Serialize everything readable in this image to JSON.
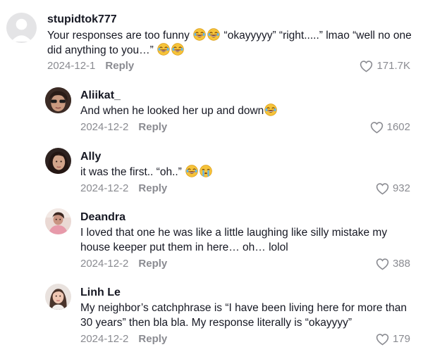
{
  "heart_icon": "heart-outline-icon",
  "colors": {
    "text": "#161823",
    "muted": "#8a8b91"
  },
  "comments": [
    {
      "username": "stupidtok777",
      "text_a": "Your responses are too funny ",
      "text_b": " “okayyyyy” “right.....” lmao “well no one did anything to you…” ",
      "date": "2024-12-1",
      "reply": "Reply",
      "likes": "171.7K"
    },
    {
      "username": "Aliikat_",
      "text_a": "And when he looked her up and down",
      "date": "2024-12-2",
      "reply": "Reply",
      "likes": "1602"
    },
    {
      "username": "Ally",
      "text_a": "it was the first.. “oh..” ",
      "date": "2024-12-2",
      "reply": "Reply",
      "likes": "932"
    },
    {
      "username": "Deandra",
      "text_a": "I loved that one he was like a little laughing like silly mistake my house keeper put them in here… oh… lolol",
      "date": "2024-12-2",
      "reply": "Reply",
      "likes": "388"
    },
    {
      "username": "Linh Le",
      "text_a": "My neighbor’s catchphrase is “I have been living here for more than 30 years” then bla bla. My response literally is “okayyyy”",
      "date": "2024-12-2",
      "reply": "Reply",
      "likes": "179"
    }
  ]
}
